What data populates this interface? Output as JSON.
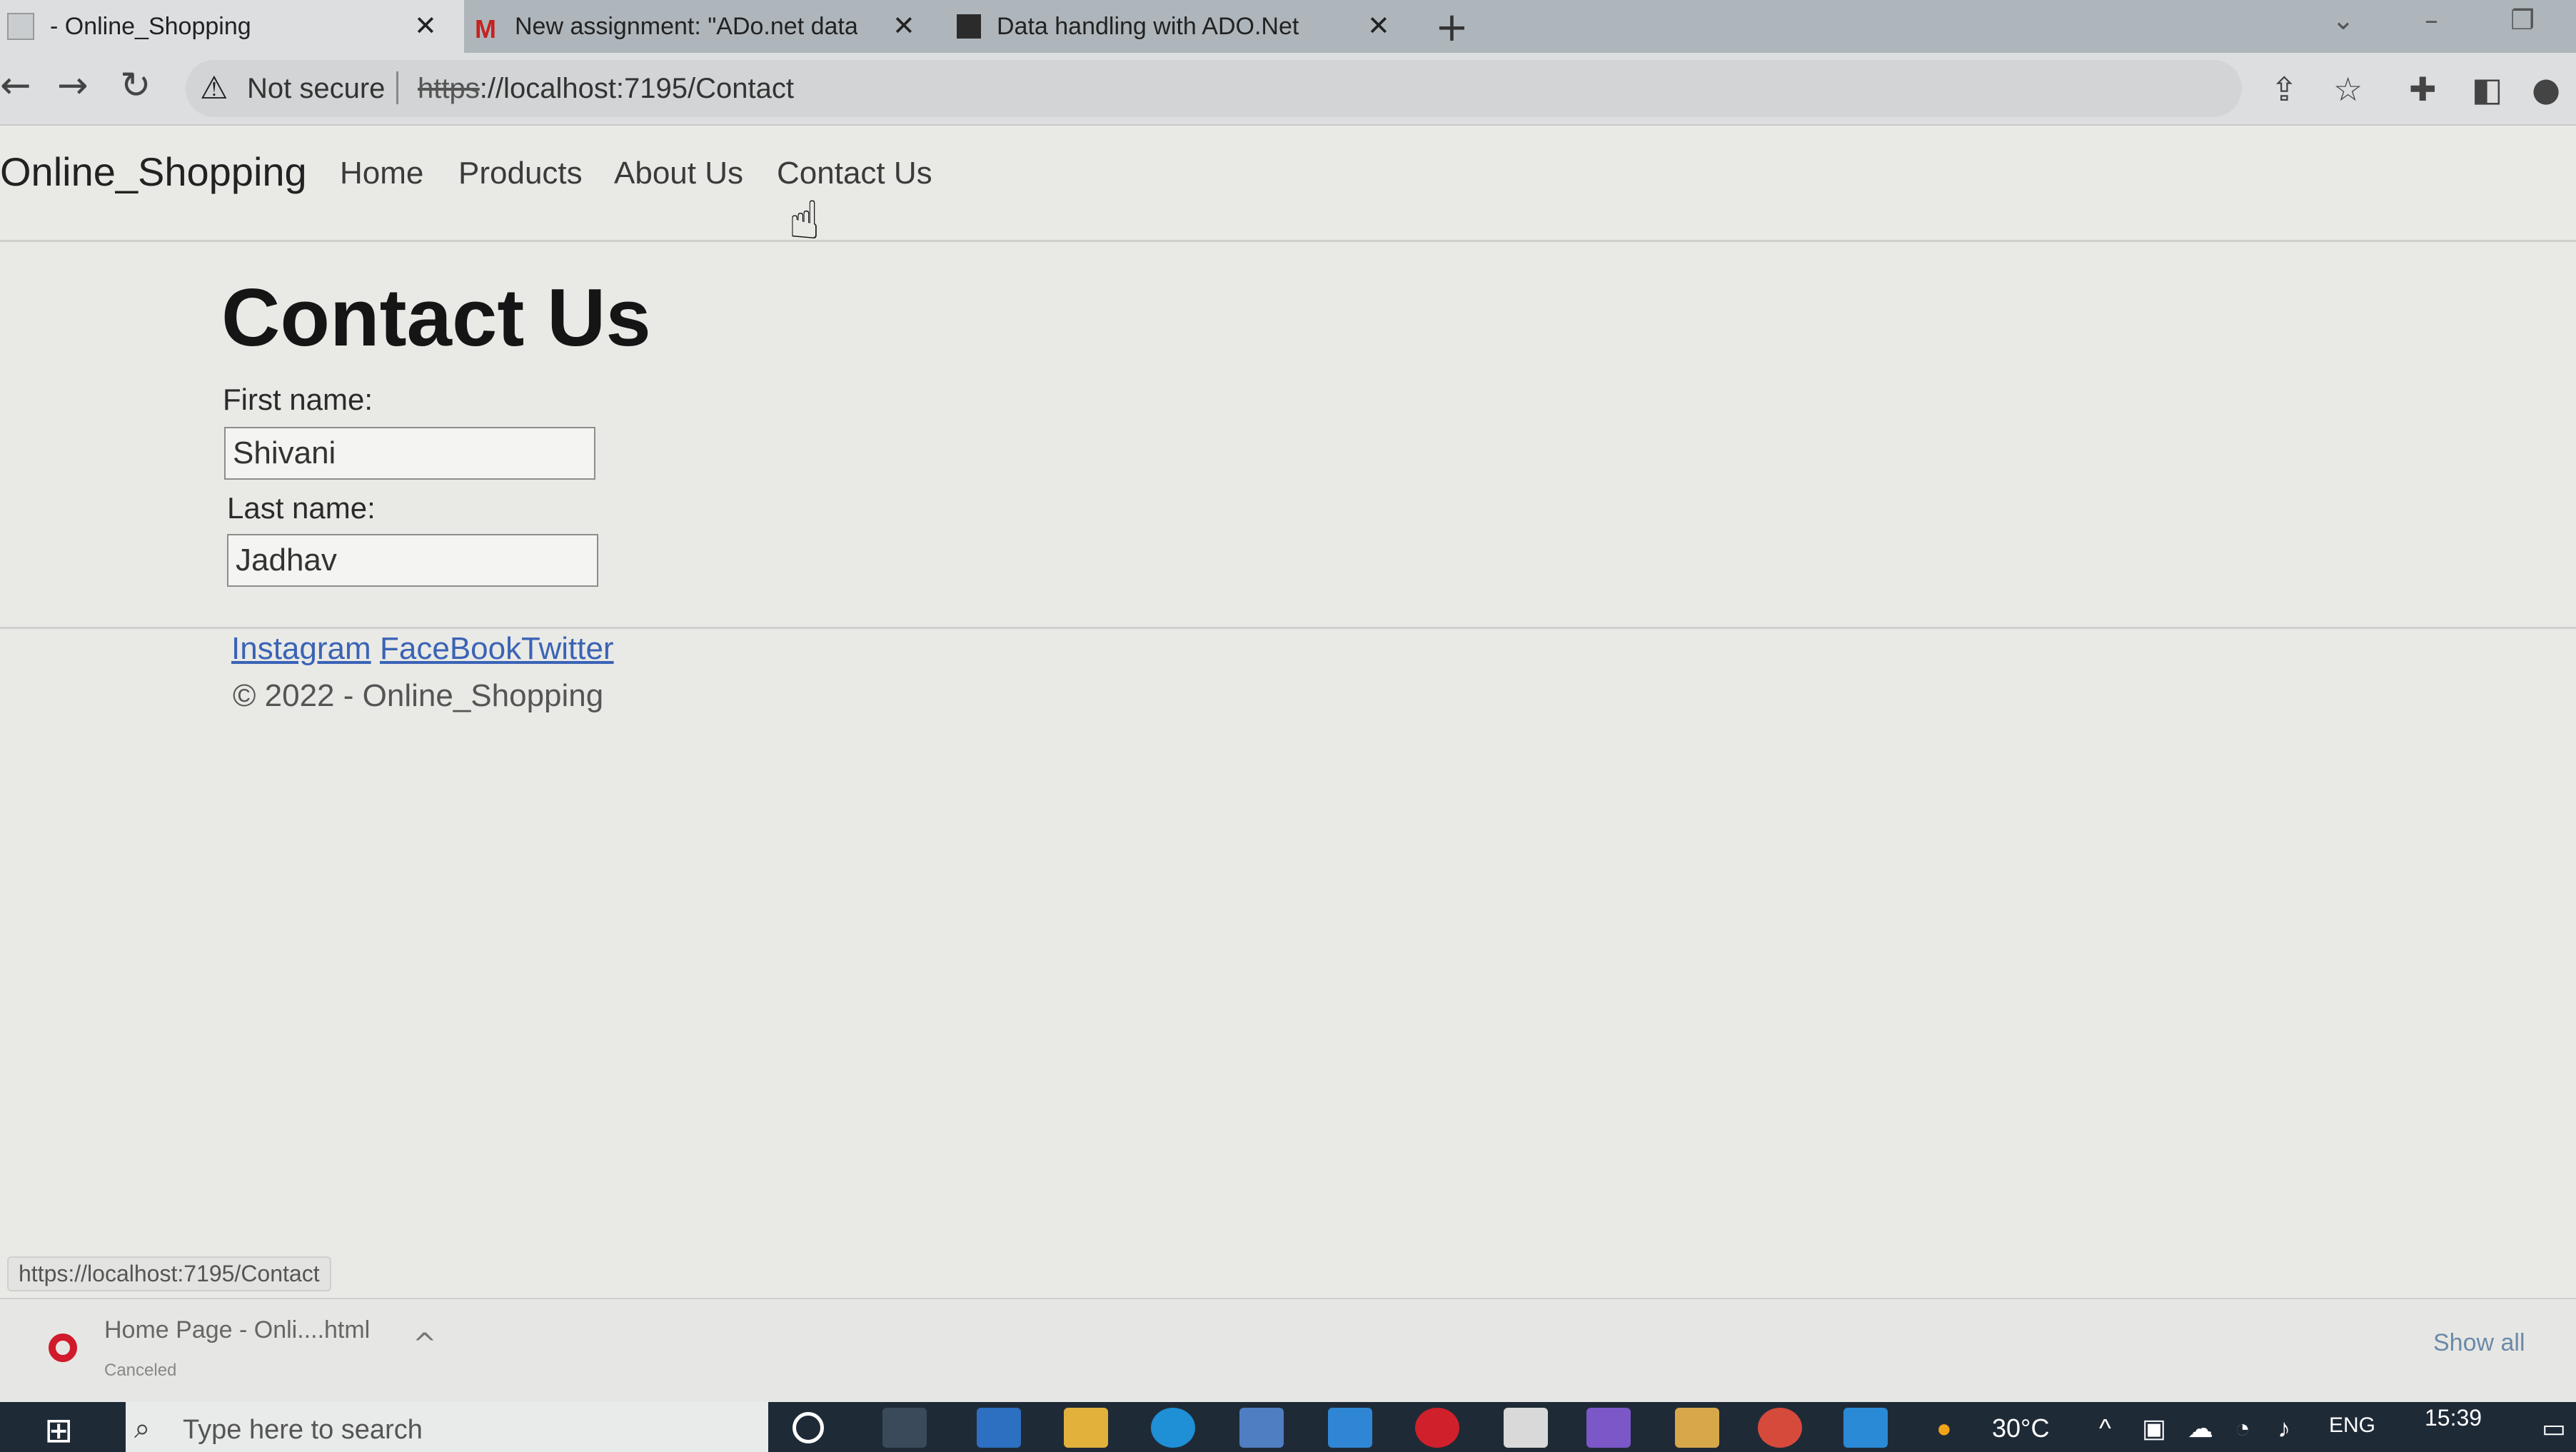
{
  "browser": {
    "tabs": [
      {
        "title": "- Online_Shopping",
        "active": true
      },
      {
        "title": "New assignment: \"ADo.net data",
        "active": false
      },
      {
        "title": "Data handling with ADO.Net",
        "active": false
      }
    ],
    "new_tab": "+",
    "security": "Not secure",
    "url_scheme": "https",
    "url_rest": "://localhost:7195/Contact"
  },
  "site": {
    "brand": "Online_Shopping",
    "nav": [
      "Home",
      "Products",
      "About Us",
      "Contact Us"
    ]
  },
  "main": {
    "title": "Contact Us",
    "first_name_label": "First name:",
    "first_name_value": "Shivani",
    "last_name_label": "Last name:",
    "last_name_value": "Jadhav"
  },
  "footer": {
    "links": [
      "Instagram",
      "FaceBook",
      "Twitter"
    ],
    "copyright": "© 2022 - Online_Shopping"
  },
  "status_bar_url": "https://localhost:7195/Contact",
  "downloads": {
    "file": "Home Page - Onli....html",
    "status": "Canceled",
    "show_all": "Show all"
  },
  "taskbar": {
    "search_placeholder": "Type here to search",
    "temperature": "30°C",
    "language": "ENG",
    "time": "15:39"
  },
  "colors": {
    "link": "#3a63b5",
    "taskbar": "#1f2a37",
    "page_bg": "#e9e9e6"
  }
}
